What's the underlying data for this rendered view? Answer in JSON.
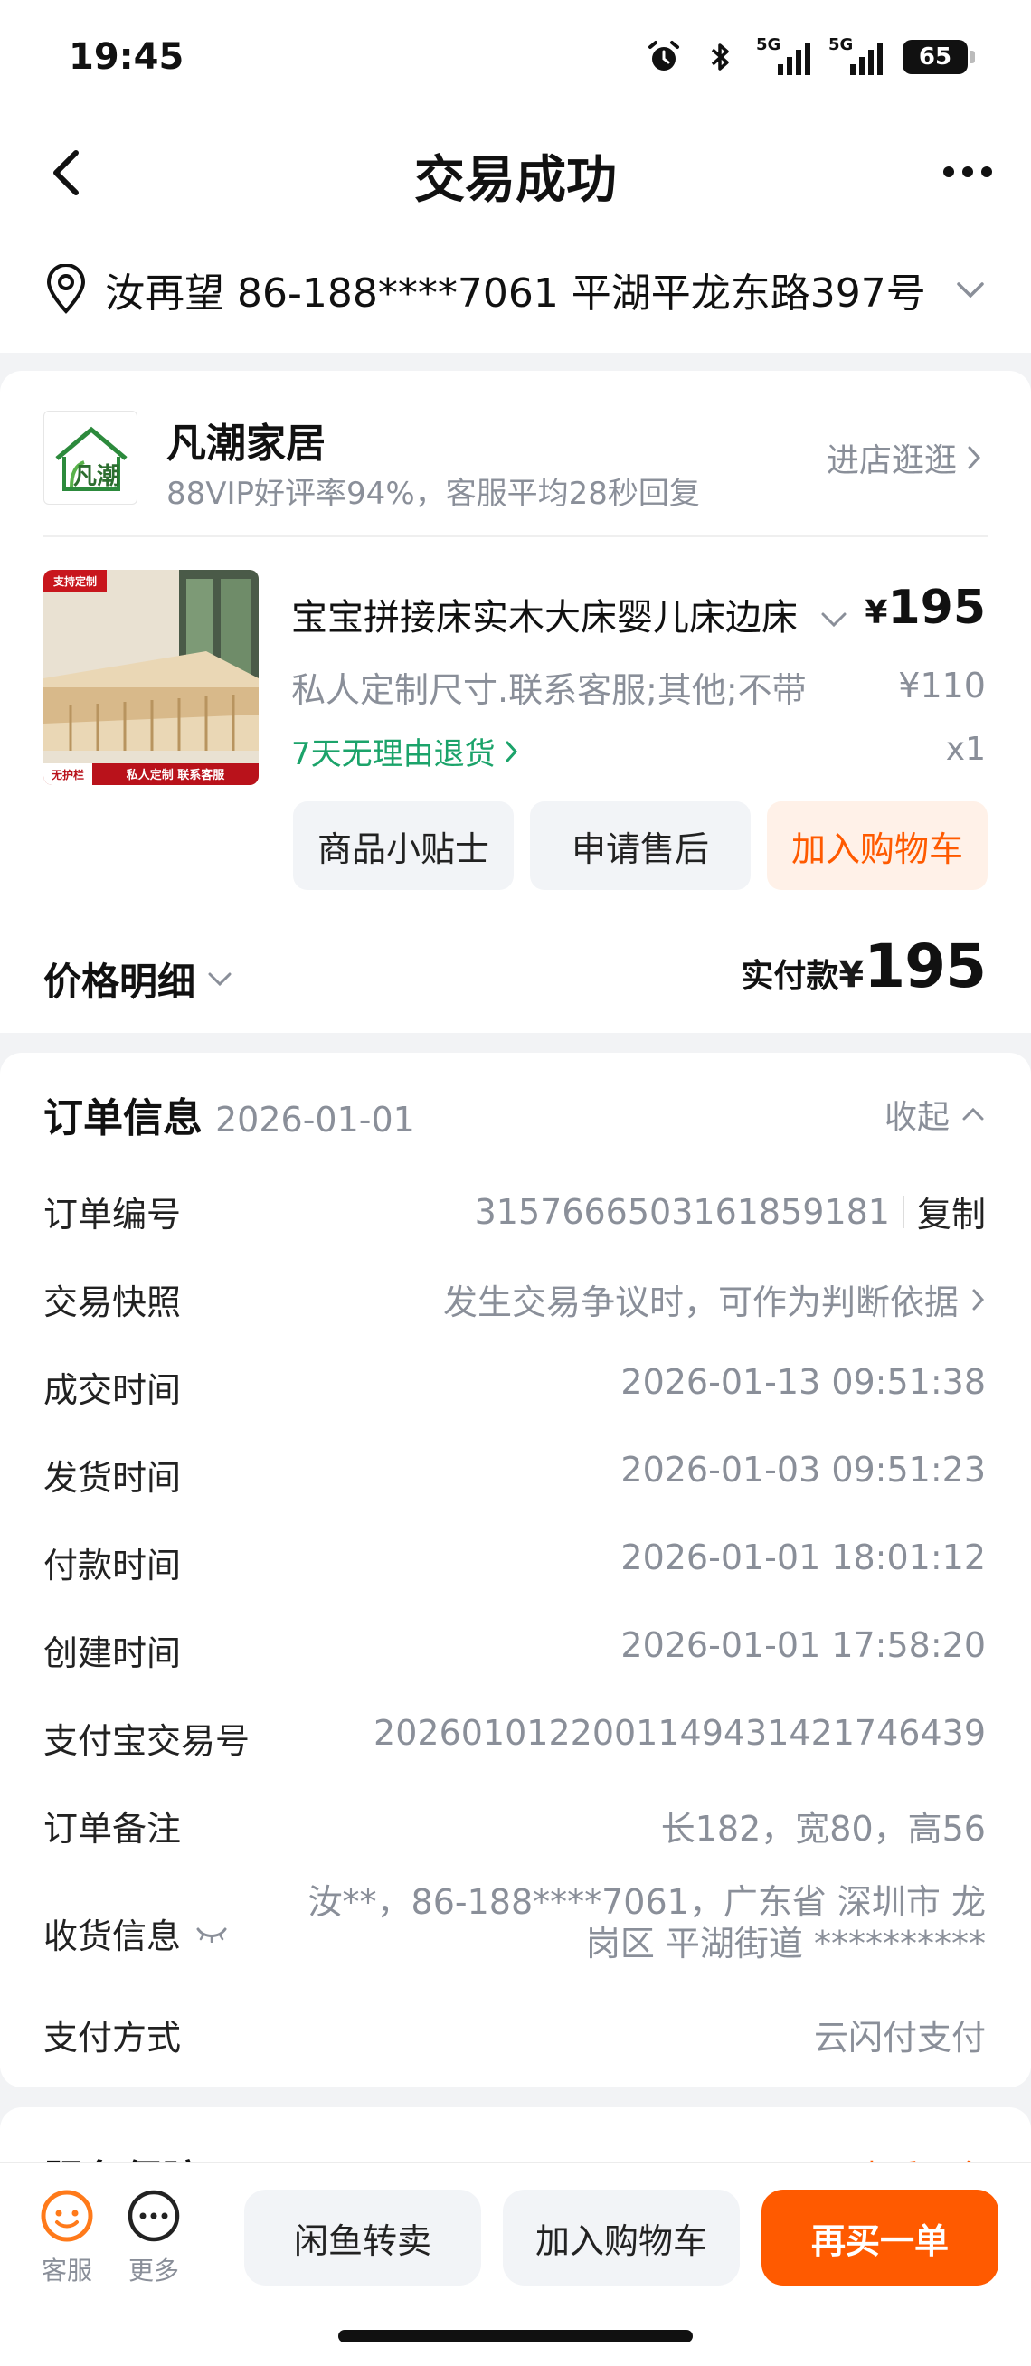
{
  "status_bar": {
    "time": "19:45",
    "battery": "65",
    "sim1": "5G",
    "sim2": "5G",
    "icons": [
      "alarm-icon",
      "bluetooth-icon",
      "signal-icon",
      "signal-icon",
      "battery-icon"
    ]
  },
  "nav": {
    "title": "交易成功"
  },
  "address": {
    "text": "汝再望  86-188****7061  平湖平龙东路397号"
  },
  "shop": {
    "name": "凡潮家居",
    "sub": "88VIP好评率94%，客服平均28秒回复",
    "visit_label": "进店逛逛",
    "logo_text": "凡潮"
  },
  "product": {
    "title": "宝宝拼接床实木大床婴儿床边床加宽床",
    "price_currency": "¥",
    "price": "195",
    "spec": "私人定制尺寸.联系客服;其他;不带",
    "original_price": "¥110",
    "return_policy": "7天无理由退货",
    "quantity": "x1",
    "image_badge_top": "支持定制",
    "image_badge_bottom_left": "无护栏",
    "image_badge_bottom_right": "私人定制 联系客服"
  },
  "actions": {
    "tips": "商品小贴士",
    "after_sale": "申请售后",
    "add_cart": "加入购物车"
  },
  "price_detail": {
    "label": "价格明细",
    "paid_label": "实付款",
    "paid_currency": "¥",
    "paid_amount": "195"
  },
  "order": {
    "title": "订单信息",
    "date": "2026-01-01",
    "collapse_label": "收起",
    "copy_label": "复制",
    "rows": [
      {
        "k": "订单编号",
        "v": "3157666503161859181"
      },
      {
        "k": "交易快照",
        "v": "发生交易争议时，可作为判断依据"
      },
      {
        "k": "成交时间",
        "v": "2026-01-13 09:51:38"
      },
      {
        "k": "发货时间",
        "v": "2026-01-03 09:51:23"
      },
      {
        "k": "付款时间",
        "v": "2026-01-01 18:01:12"
      },
      {
        "k": "创建时间",
        "v": "2026-01-01 17:58:20"
      },
      {
        "k": "支付宝交易号",
        "v": "2026010122001149431421746439"
      },
      {
        "k": "订单备注",
        "v": "长182，宽80，高56"
      },
      {
        "k": "收货信息",
        "v": "汝**，86-188****7061，广东省 深圳市 龙岗区 平湖街道 **********"
      },
      {
        "k": "支付方式",
        "v": "云闪付支付"
      }
    ]
  },
  "service": {
    "title": "服务保障",
    "more": "查看更多"
  },
  "bottom": {
    "service_label": "客服",
    "more_label": "更多",
    "resell": "闲鱼转卖",
    "add_cart": "加入购物车",
    "rebuy": "再买一单"
  },
  "colors": {
    "accent": "#ff5a00",
    "green": "#1ba36a",
    "muted": "#8a8f99"
  }
}
